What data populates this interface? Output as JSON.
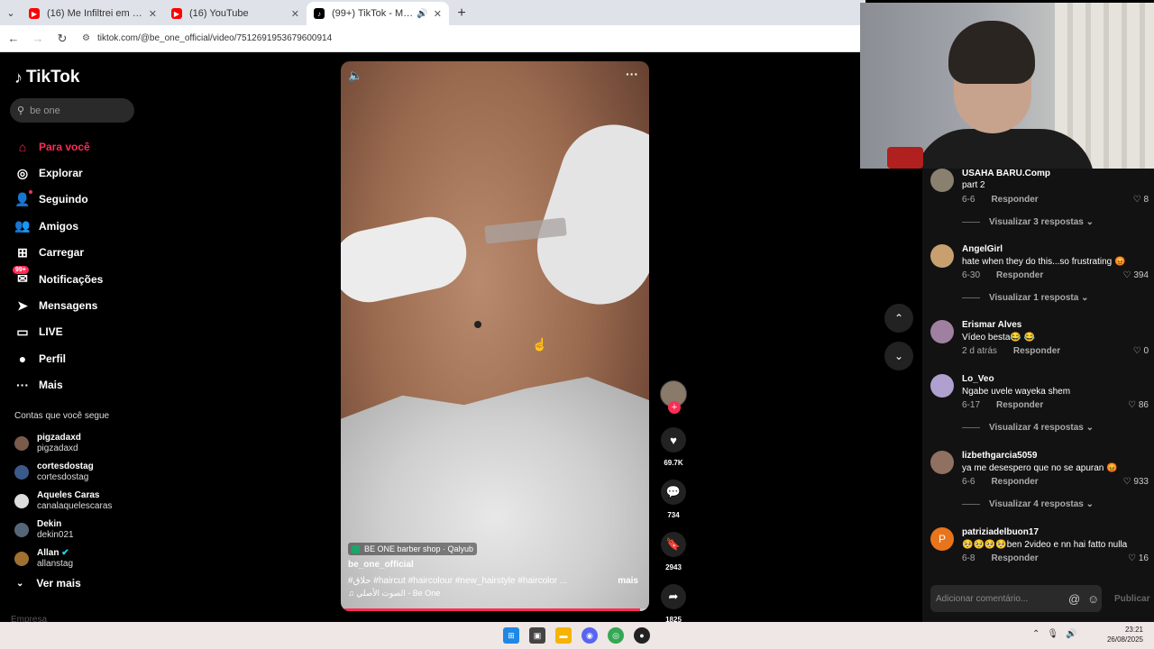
{
  "browser": {
    "tabs": [
      {
        "title": "(16) Me Infiltrei em um MERCADO",
        "favicon_color": "#ff0000",
        "active": false
      },
      {
        "title": "(16) YouTube",
        "favicon_color": "#ff0000",
        "active": false
      },
      {
        "title": "(99+) TikTok - Make Your Day",
        "favicon_color": "#000000",
        "active": true
      }
    ],
    "url": "tiktok.com/@be_one_official/video/7512691953679600914"
  },
  "sidebar": {
    "logo": "TikTok",
    "search_value": "be one",
    "menu": [
      {
        "label": "Para você",
        "icon": "home-icon",
        "glyph": "⌂"
      },
      {
        "label": "Explorar",
        "icon": "compass-icon",
        "glyph": "◎"
      },
      {
        "label": "Seguindo",
        "icon": "following-icon",
        "glyph": "👤"
      },
      {
        "label": "Amigos",
        "icon": "friends-icon",
        "glyph": "👥"
      },
      {
        "label": "Carregar",
        "icon": "upload-icon",
        "glyph": "⊞"
      },
      {
        "label": "Notificações",
        "icon": "inbox-icon",
        "glyph": "✉"
      },
      {
        "label": "Mensagens",
        "icon": "send-icon",
        "glyph": "➤"
      },
      {
        "label": "LIVE",
        "icon": "live-icon",
        "glyph": "▭"
      },
      {
        "label": "Perfil",
        "icon": "profile-icon",
        "glyph": "●"
      },
      {
        "label": "Mais",
        "icon": "more-icon",
        "glyph": "···"
      }
    ],
    "notif_badge": "99+",
    "follows_title": "Contas que você segue",
    "follows": [
      {
        "name": "pigzadaxd",
        "user": "pigzadaxd",
        "color": "#7a5a4a"
      },
      {
        "name": "cortesdostag",
        "user": "cortesdostag",
        "color": "#3a5a8a"
      },
      {
        "name": "Aqueles Caras",
        "user": "canalaquelescaras",
        "color": "#dddddd"
      },
      {
        "name": "Dekin",
        "user": "dekin021",
        "color": "#556677"
      },
      {
        "name": "Allan",
        "user": "allanstag",
        "color": "#a07030"
      }
    ],
    "ver_mais": "Ver mais",
    "empresa": "Empresa"
  },
  "video": {
    "shop": "BE ONE barber shop · Qalyub",
    "username": "be_one_official",
    "tags": "#حلاق  #haircut  #haircolour  #new_hairstyle  #haircolor  ...",
    "mais": "mais",
    "music": "♫ الصوت الأصلي - Be One",
    "progress": 0.97
  },
  "actions": {
    "likes": "69.7K",
    "comments": "734",
    "saves": "2943",
    "shares": "1825"
  },
  "comments": {
    "items": [
      {
        "name": "USAHA BARU.Comp",
        "text": "part 2",
        "date": "6-6",
        "likes": "8",
        "replies": "Visualizar 3 respostas",
        "color": "#8a8070"
      },
      {
        "name": "AngelGirl",
        "text": "hate when they do this...so frustrating 😡",
        "date": "6-30",
        "likes": "394",
        "replies": "Visualizar 1 resposta",
        "color": "#c8a070"
      },
      {
        "name": "Erismar Alves",
        "text": "Vídeo besta😂 😂",
        "date": "2 d atrás",
        "likes": "0",
        "replies": "",
        "color": "#a080a0"
      },
      {
        "name": "Lo_Veo",
        "text": "Ngabe uvele wayeka shem",
        "date": "6-17",
        "likes": "86",
        "replies": "Visualizar 4 respostas",
        "color": "#b0a0d0"
      },
      {
        "name": "lizbethgarcia5059",
        "text": "ya me desespero que no se apuran 😡",
        "date": "6-6",
        "likes": "933",
        "replies": "Visualizar 4 respostas",
        "color": "#907060"
      },
      {
        "name": "patriziadelbuon17",
        "text": "🥺🥺🥺🥺ben 2video e nn hai fatto nulla",
        "date": "6-8",
        "likes": "16",
        "replies": "",
        "color": "#e8741c",
        "initial": "P"
      }
    ],
    "responder": "Responder",
    "input_placeholder": "Adicionar comentário...",
    "publicar": "Publicar"
  },
  "taskbar": {
    "time": "23:21",
    "date": "26/08/2025"
  }
}
